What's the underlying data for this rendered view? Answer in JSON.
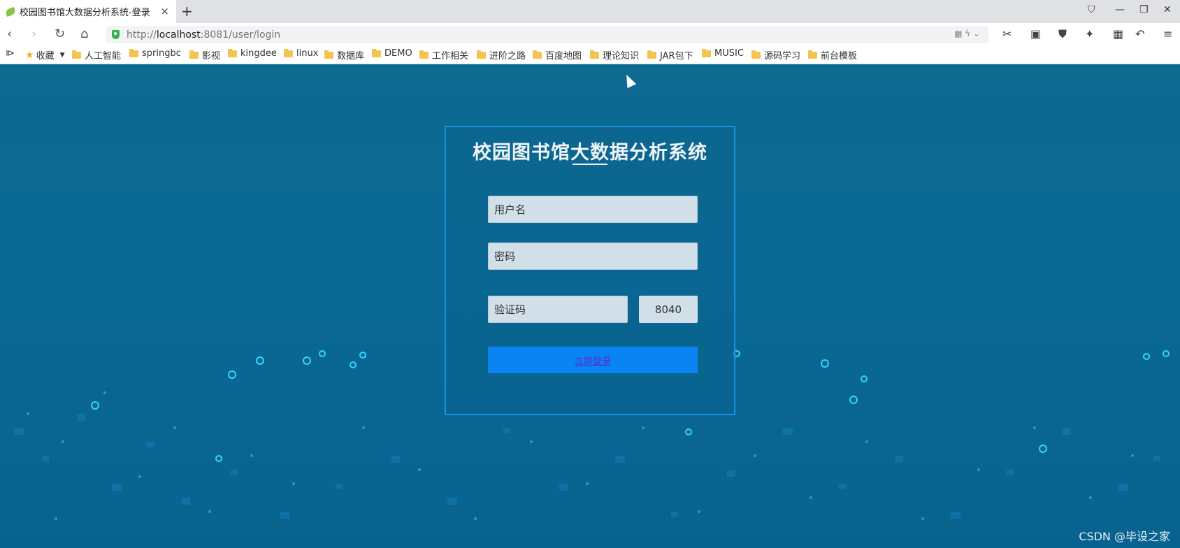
{
  "browser": {
    "tab_title": "校园图书馆大数据分析系统-登录",
    "tab_close": "×",
    "new_tab": "+",
    "url_prefix": "http://",
    "url_host": "localhost",
    "url_rest": ":8081/user/login",
    "bookmarks_label": "收藏",
    "bookmarks": [
      "人工智能",
      "springbc",
      "影视",
      "kingdee",
      "linux",
      "数据库",
      "DEMO",
      "工作相关",
      "进阶之路",
      "百度地图",
      "理论知识",
      "JAR包下",
      "MUSIC",
      "源码学习",
      "前台模板"
    ]
  },
  "login": {
    "title": "校园图书馆大数据分析系统",
    "username_placeholder": "用户名",
    "password_placeholder": "密码",
    "captcha_placeholder": "验证码",
    "captcha_code": "8040",
    "submit_label": "立即登录"
  },
  "watermark": "CSDN @毕设之家",
  "colors": {
    "background": "#0a6690",
    "panel_border": "#1a8fe3",
    "submit_button": "#0a84f2"
  }
}
